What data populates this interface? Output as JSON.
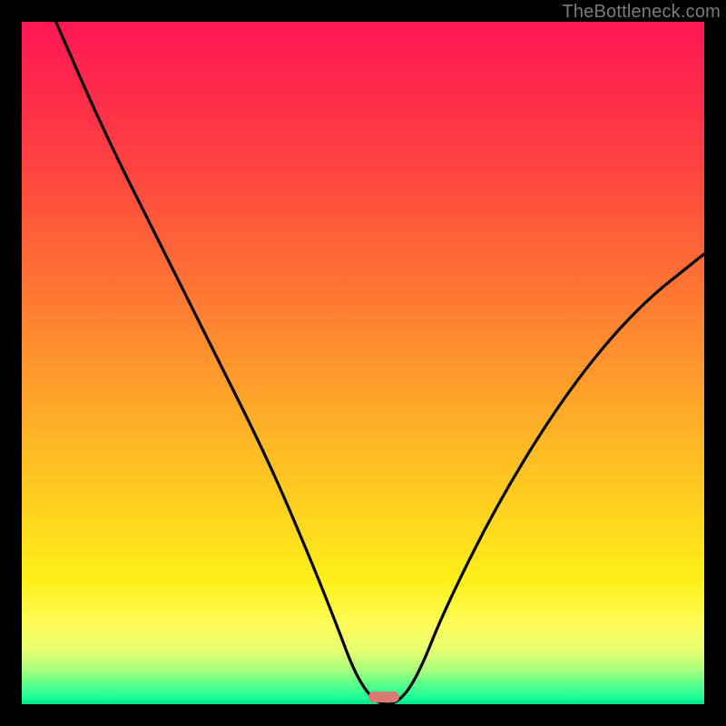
{
  "watermark": "TheBottleneck.com",
  "chart_data": {
    "type": "line",
    "title": "",
    "xlabel": "",
    "ylabel": "",
    "xlim": [
      0,
      100
    ],
    "ylim": [
      0,
      100
    ],
    "grid": false,
    "legend": false,
    "series": [
      {
        "name": "bottleneck-curve",
        "x": [
          5,
          12,
          20,
          28,
          36,
          42,
          46,
          49,
          52,
          55,
          58,
          62,
          70,
          80,
          90,
          100
        ],
        "y": [
          100,
          84,
          68,
          52,
          36,
          22,
          12,
          4,
          0,
          0,
          4,
          14,
          30,
          46,
          58,
          66
        ]
      }
    ],
    "markers": [
      {
        "name": "target-zone",
        "x": 53,
        "y": 0,
        "color": "#d97a74"
      }
    ],
    "background_gradient": {
      "direction": "vertical",
      "stops": [
        {
          "pos": 0.0,
          "color": "#ff1854"
        },
        {
          "pos": 0.48,
          "color": "#ff8f2e"
        },
        {
          "pos": 0.82,
          "color": "#fff01a"
        },
        {
          "pos": 1.0,
          "color": "#05e28b"
        }
      ]
    }
  }
}
